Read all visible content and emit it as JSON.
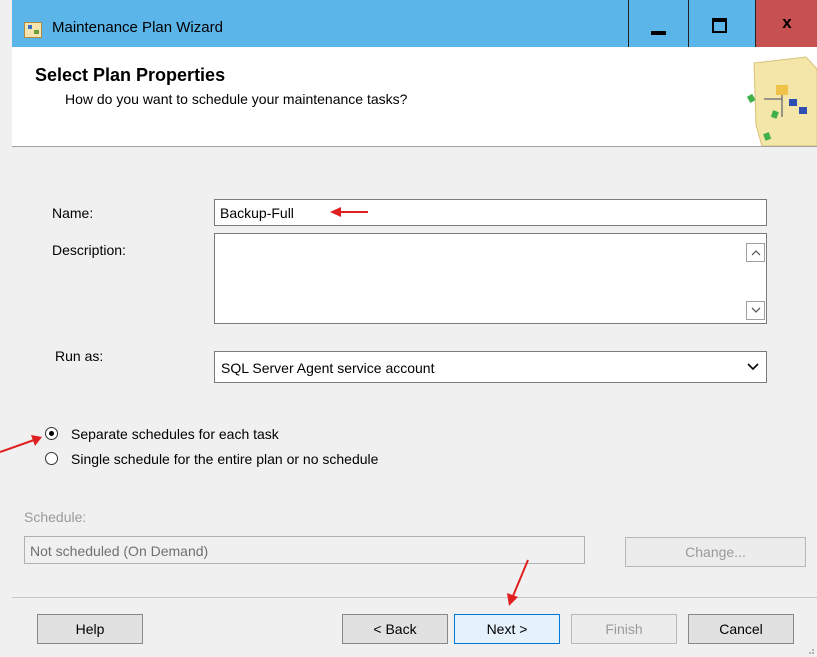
{
  "window": {
    "title": "Maintenance Plan Wizard",
    "controls": {
      "minimize": "minimize-icon",
      "maximize": "maximize-icon",
      "close": "close-icon",
      "close_glyph": "x"
    }
  },
  "header": {
    "title": "Select Plan Properties",
    "subtitle": "How do you want to schedule your maintenance tasks?"
  },
  "form": {
    "name_label": "Name:",
    "name_value": "Backup-Full",
    "description_label": "Description:",
    "description_value": "",
    "run_as_label": "Run as:",
    "run_as_value": "SQL Server Agent service account"
  },
  "schedule_options": [
    {
      "label": "Separate schedules for each task",
      "selected": true
    },
    {
      "label": "Single schedule for the entire plan or no schedule",
      "selected": false
    }
  ],
  "schedule": {
    "label": "Schedule:",
    "value": "Not scheduled (On Demand)",
    "change_label": "Change..."
  },
  "footer": {
    "help": "Help",
    "back": "< Back",
    "next": "Next >",
    "finish": "Finish",
    "cancel": "Cancel"
  },
  "colors": {
    "titlebar": "#5bb5e8",
    "close_button": "#c75050",
    "annotation_arrow": "#e02020",
    "dialog_background": "#f0f0f0"
  }
}
